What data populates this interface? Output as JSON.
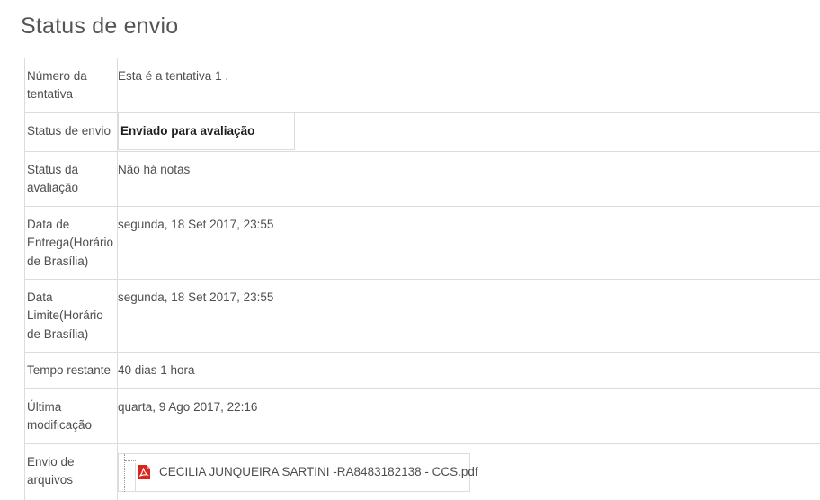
{
  "page": {
    "title": "Status de envio"
  },
  "rows": {
    "attempt": {
      "label": "Número da tentativa",
      "value": "Esta é a tentativa 1 ."
    },
    "submission_status": {
      "label": "Status de envio",
      "value": "Enviado para avaliação"
    },
    "grading_status": {
      "label": "Status da avaliação",
      "value": "Não há notas"
    },
    "submitted_date": {
      "label": "Data de Entrega(Horário de Brasília)",
      "value": "segunda, 18 Set 2017, 23:55"
    },
    "deadline": {
      "label": "Data Limite(Horário de Brasília)",
      "value": "segunda, 18 Set 2017, 23:55"
    },
    "time_remaining": {
      "label": "Tempo restante",
      "value": "40 dias 1 hora"
    },
    "last_modified": {
      "label": "Última modificação",
      "value": "quarta, 9 Ago 2017, 22:16"
    },
    "file_submissions": {
      "label": "Envio de arquivos",
      "file_name": "CECILIA JUNQUEIRA SARTINI -RA8483182138 - CCS.pdf",
      "file_icon": "pdf-icon"
    }
  },
  "colors": {
    "pdf_red": "#d8261e",
    "border": "#dcdcdc",
    "text": "#4e4e4e"
  }
}
